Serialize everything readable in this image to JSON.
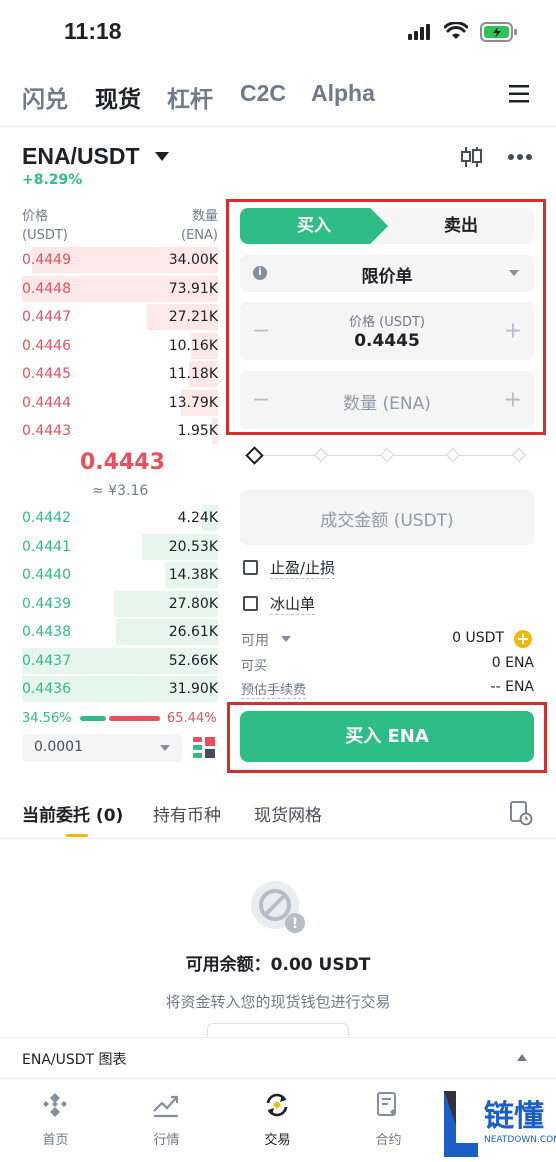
{
  "status_bar": {
    "time": "11:18"
  },
  "top_nav": {
    "items": [
      {
        "label": "闪兑"
      },
      {
        "label": "现货"
      },
      {
        "label": "杠杆"
      },
      {
        "label": "C2C"
      },
      {
        "label": "Alpha"
      }
    ],
    "active": "现货"
  },
  "market": {
    "pair": "ENA/USDT",
    "change": "+8.29%"
  },
  "orderbook": {
    "price_header": "价格",
    "price_unit": "(USDT)",
    "qty_header": "数量",
    "qty_unit": "(ENA)",
    "asks": [
      {
        "price": "0.4449",
        "qty": "34.00K",
        "depth": 0.95
      },
      {
        "price": "0.4448",
        "qty": "73.91K",
        "depth": 1.0
      },
      {
        "price": "0.4447",
        "qty": "27.21K",
        "depth": 0.36
      },
      {
        "price": "0.4446",
        "qty": "10.16K",
        "depth": 0.14
      },
      {
        "price": "0.4445",
        "qty": "11.18K",
        "depth": 0.15
      },
      {
        "price": "0.4444",
        "qty": "13.79K",
        "depth": 0.19
      },
      {
        "price": "0.4443",
        "qty": "1.95K",
        "depth": 0.03
      }
    ],
    "mid_price": "0.4443",
    "mid_cny": "≈ ¥3.16",
    "bids": [
      {
        "price": "0.4442",
        "qty": "4.24K",
        "depth": 0.08
      },
      {
        "price": "0.4441",
        "qty": "20.53K",
        "depth": 0.39
      },
      {
        "price": "0.4440",
        "qty": "14.38K",
        "depth": 0.27
      },
      {
        "price": "0.4439",
        "qty": "27.80K",
        "depth": 0.53
      },
      {
        "price": "0.4438",
        "qty": "26.61K",
        "depth": 0.52
      },
      {
        "price": "0.4437",
        "qty": "52.66K",
        "depth": 1.0
      },
      {
        "price": "0.4436",
        "qty": "31.90K",
        "depth": 1.0
      }
    ],
    "buy_ratio": "34.56%",
    "sell_ratio": "65.44%",
    "buy_ratio_value": 0.3456,
    "precision": "0.0001"
  },
  "order_form": {
    "buy_tab": "买入",
    "sell_tab": "卖出",
    "order_type": "限价单",
    "price_label": "价格 (USDT)",
    "price_value": "0.4445",
    "qty_placeholder": "数量 (ENA)",
    "total_placeholder": "成交金额 (USDT)",
    "tp_sl_label": "止盈/止损",
    "iceberg_label": "冰山单",
    "available_label": "可用",
    "available_value": "0 USDT",
    "can_buy_label": "可买",
    "can_buy_value": "0 ENA",
    "fee_label": "预估手续费",
    "fee_value": "-- ENA",
    "buy_button": "买入 ENA"
  },
  "bottom_tabs": {
    "items": [
      {
        "label": "当前委托 (0)"
      },
      {
        "label": "持有币种"
      },
      {
        "label": "现货网格"
      }
    ]
  },
  "empty_state": {
    "title": "可用余额：0.00 USDT",
    "subtitle": "将资金转入您的现货钱包进行交易"
  },
  "chart_bar": {
    "label": "ENA/USDT 图表"
  },
  "bottom_nav": {
    "items": [
      {
        "label": "首页",
        "icon": "home-icon"
      },
      {
        "label": "行情",
        "icon": "markets-icon"
      },
      {
        "label": "交易",
        "icon": "trade-icon"
      },
      {
        "label": "合约",
        "icon": "futures-icon"
      }
    ],
    "active": "交易"
  },
  "watermark": {
    "text": "链懂",
    "sub": "NEATDOWN.COM"
  },
  "colors": {
    "buy": "#2ebd85",
    "sell": "#e8505b",
    "accent": "#f0b90b",
    "highlight": "#d62d2d"
  }
}
